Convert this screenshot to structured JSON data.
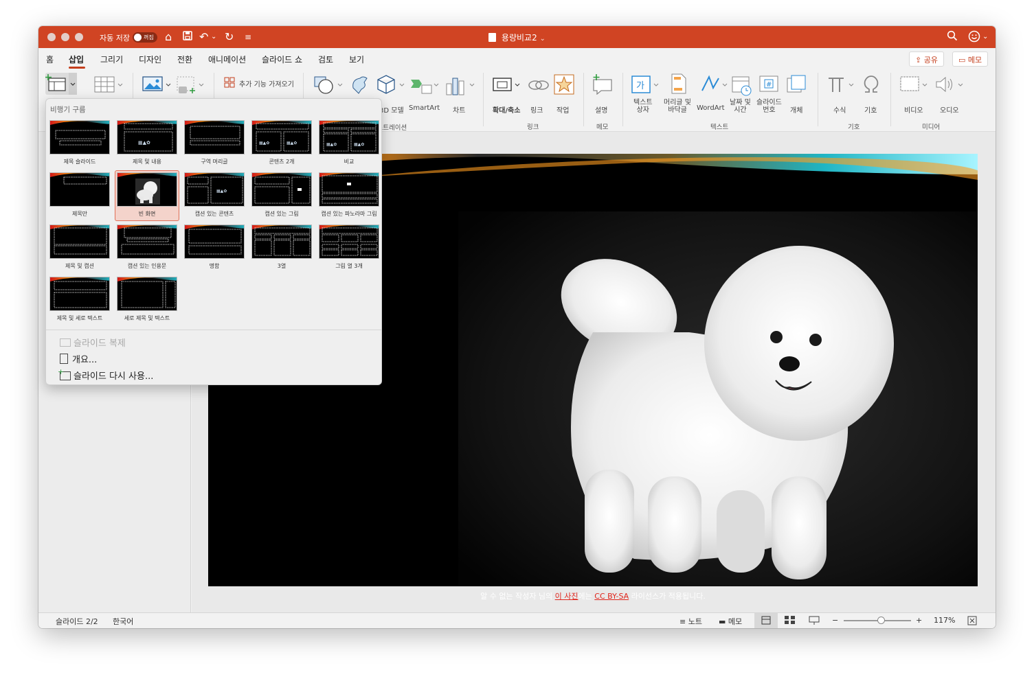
{
  "titlebar": {
    "autosave_label": "자동 저장",
    "autosave_state": "꺼짐",
    "document_title": "용량비교2",
    "chevron": "⌄"
  },
  "tabs": [
    "홈",
    "삽입",
    "그리기",
    "디자인",
    "전환",
    "애니메이션",
    "슬라이드 쇼",
    "검토",
    "보기"
  ],
  "active_tab": "삽입",
  "share_label": "공유",
  "comment_label": "메모",
  "ribbon": {
    "addins_label": "추가 기능 가져오기",
    "model_3d": "3D 모델",
    "smartart": "SmartArt",
    "chart": "차트",
    "illustration_group": "일러스트레이션",
    "zoom": "확대/축소",
    "link": "링크",
    "action": "작업",
    "link_group": "링크",
    "comment": "설명",
    "comment_group": "메모",
    "textbox": "텍스트\n상자",
    "header_footer": "머리글 및\n바닥글",
    "wordart": "WordArt",
    "date_time": "날짜 및\n시간",
    "slide_number": "슬라이드\n번호",
    "object": "개체",
    "text_group": "텍스트",
    "equation": "수식",
    "symbol": "기호",
    "symbols_group": "기호",
    "video": "비디오",
    "audio": "오디오",
    "media_group": "미디어"
  },
  "layout_menu": {
    "header": "비행기 구름",
    "layouts": [
      {
        "label": "제목 슬라이드",
        "kind": "title"
      },
      {
        "label": "제목 및 내용",
        "kind": "content"
      },
      {
        "label": "구역 머리글",
        "kind": "section"
      },
      {
        "label": "콘텐츠 2개",
        "kind": "two"
      },
      {
        "label": "비교",
        "kind": "compare"
      },
      {
        "label": "제목만",
        "kind": "titleonly"
      },
      {
        "label": "빈 화면",
        "kind": "blank"
      },
      {
        "label": "캡션 있는 콘텐츠",
        "kind": "captioncontent"
      },
      {
        "label": "캡션 있는 그림",
        "kind": "captionpic"
      },
      {
        "label": "캡션 있는 파노라마 그림",
        "kind": "panorama"
      },
      {
        "label": "제목 및 캡션",
        "kind": "titlecaption"
      },
      {
        "label": "캡션 있는 인용문",
        "kind": "quote"
      },
      {
        "label": "명함",
        "kind": "namecard"
      },
      {
        "label": "3열",
        "kind": "threecol"
      },
      {
        "label": "그림 열 3개",
        "kind": "threepic"
      },
      {
        "label": "제목 및 세로 텍스트",
        "kind": "verttext"
      },
      {
        "label": "세로 제목 및 텍스트",
        "kind": "verttitle"
      }
    ],
    "selected": "빈 화면",
    "duplicate_label": "슬라이드 복제",
    "outline_label": "개요...",
    "reuse_label": "슬라이드 다시 사용..."
  },
  "caption": {
    "prefix": "알 수 없는 작성자 님의 ",
    "link1": "이 사진",
    "middle": "에는 ",
    "link2": "CC BY-SA",
    "suffix": " 라이선스가 적용됩니다."
  },
  "status": {
    "slide": "슬라이드 2/2",
    "language": "한국어",
    "notes": "노트",
    "comments": "메모",
    "zoom": "117%",
    "zoom_level": 0.55
  },
  "colors": {
    "accent": "#c43e1c",
    "titlebar": "#d04423",
    "link": "#e0241b"
  }
}
